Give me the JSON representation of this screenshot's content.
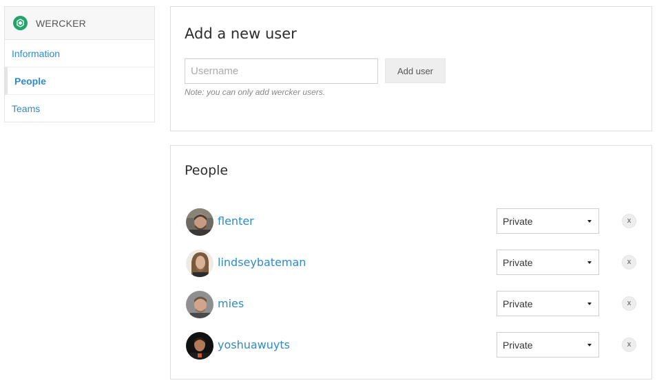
{
  "sidebar": {
    "org_name": "WERCKER",
    "org_logo_icon": "wercker-logo-icon",
    "brand_color": "#24a36b",
    "items": [
      {
        "label": "Information",
        "active": false
      },
      {
        "label": "People",
        "active": true
      },
      {
        "label": "Teams",
        "active": false
      }
    ]
  },
  "add_user": {
    "title": "Add a new user",
    "input_placeholder": "Username",
    "input_value": "",
    "button_label": "Add user",
    "note": "Note: you can only add wercker users."
  },
  "people": {
    "title": "People",
    "remove_label": "x",
    "users": [
      {
        "username": "flenter",
        "role": "Private"
      },
      {
        "username": "lindseybateman",
        "role": "Private"
      },
      {
        "username": "mies",
        "role": "Private"
      },
      {
        "username": "yoshuawuyts",
        "role": "Private"
      }
    ]
  },
  "colors": {
    "link": "#2f8bc6",
    "border": "#dedede"
  }
}
